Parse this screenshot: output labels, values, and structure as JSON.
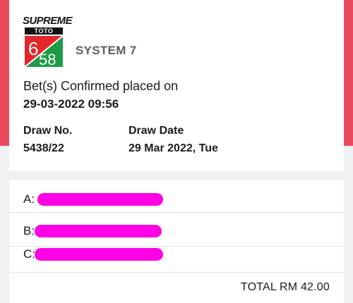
{
  "logo": {
    "brand_word": "SUPREME",
    "sub_word": "TOTO",
    "numerator": "6",
    "denominator": "58"
  },
  "ticket": {
    "system": "SYSTEM 7",
    "confirmation_label": "Bet(s) Confirmed placed on",
    "confirmation_datetime": "29-03-2022 09:56",
    "draw_no_label": "Draw No.",
    "draw_no_value": "5438/22",
    "draw_date_label": "Draw Date",
    "draw_date_value": "29 Mar 2022, Tue"
  },
  "bets": [
    {
      "label": "A:",
      "numbers": ""
    },
    {
      "label": "B:",
      "numbers": ""
    },
    {
      "label": "C:",
      "numbers": ""
    }
  ],
  "total": "TOTAL RM 42.00",
  "colors": {
    "accent_red": "#e94b5c",
    "logo_green": "#1f9a48",
    "logo_red": "#e3262a",
    "redaction_magenta": "#ff00e6",
    "muted_text": "#5f6063"
  }
}
